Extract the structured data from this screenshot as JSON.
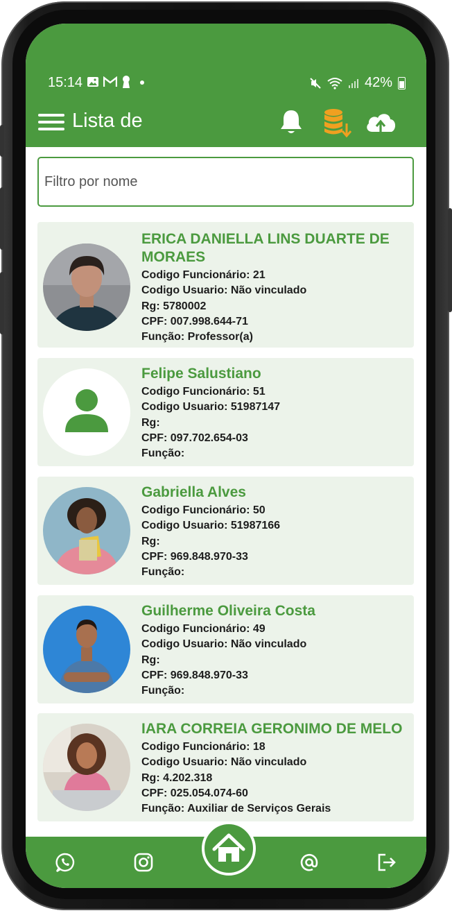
{
  "status_bar": {
    "time": "15:14",
    "battery": "42%",
    "left_icons": [
      "image-icon",
      "gmail-icon",
      "keyhole-icon",
      "dot-icon"
    ],
    "right_icons": [
      "mute-vibrate-icon",
      "wifi-icon",
      "signal-icon",
      "battery-icon"
    ]
  },
  "toolbar": {
    "title": "Lista de",
    "icons": [
      "menu-icon",
      "bell-icon",
      "database-download-icon",
      "cloud-upload-icon"
    ]
  },
  "search": {
    "placeholder": "Filtro por nome",
    "value": ""
  },
  "employees": [
    {
      "name": "ERICA DANIELLA LINS DUARTE DE MORAES",
      "codigo_funcionario": "Codigo Funcionário: 21",
      "codigo_usuario": "Codigo Usuario: Não vinculado",
      "rg": "Rg: 5780002",
      "cpf": "CPF: 007.998.644-71",
      "funcao": "Função: Professor(a)",
      "avatar": "photo"
    },
    {
      "name": "Felipe Salustiano",
      "codigo_funcionario": "Codigo Funcionário: 51",
      "codigo_usuario": "Codigo Usuario: 51987147",
      "rg": "Rg:",
      "cpf": "CPF: 097.702.654-03",
      "funcao": "Função:",
      "avatar": "placeholder-person-icon"
    },
    {
      "name": "Gabriella Alves",
      "codigo_funcionario": "Codigo Funcionário: 50",
      "codigo_usuario": "Codigo Usuario: 51987166",
      "rg": "Rg:",
      "cpf": "CPF: 969.848.970-33",
      "funcao": "Função:",
      "avatar": "photo"
    },
    {
      "name": "Guilherme Oliveira Costa",
      "codigo_funcionario": "Codigo Funcionário: 49",
      "codigo_usuario": "Codigo Usuario: Não vinculado",
      "rg": "Rg:",
      "cpf": "CPF: 969.848.970-33",
      "funcao": "Função:",
      "avatar": "photo"
    },
    {
      "name": "IARA CORREIA GERONIMO DE MELO",
      "codigo_funcionario": "Codigo Funcionário: 18",
      "codigo_usuario": "Codigo Usuario: Não vinculado",
      "rg": "Rg: 4.202.318",
      "cpf": "CPF: 025.054.074-60",
      "funcao": "Função: Auxiliar de Serviços Gerais",
      "avatar": "photo"
    }
  ],
  "bottom_nav": {
    "items": [
      "whatsapp-icon",
      "instagram-icon",
      "home-icon",
      "at-sign-icon",
      "logout-icon"
    ]
  },
  "colors": {
    "primary_green": "#4b9a3f",
    "card_background": "#ecf3ea",
    "accent_orange": "#f0a020"
  }
}
